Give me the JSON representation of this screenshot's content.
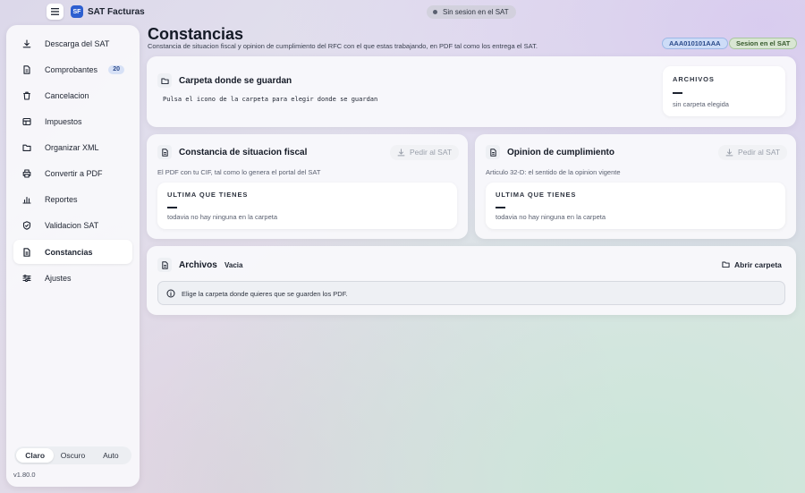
{
  "app": {
    "logo": "SF",
    "title": "SAT Facturas"
  },
  "session_status": "Sin sesion en el SAT",
  "sidebar": {
    "items": [
      {
        "label": "Descarga del SAT",
        "icon": "download-icon"
      },
      {
        "label": "Comprobantes",
        "icon": "document-icon",
        "badge": "20"
      },
      {
        "label": "Cancelacion",
        "icon": "trash-icon"
      },
      {
        "label": "Impuestos",
        "icon": "table-icon"
      },
      {
        "label": "Organizar XML",
        "icon": "folder-icon"
      },
      {
        "label": "Convertir a PDF",
        "icon": "printer-icon"
      },
      {
        "label": "Reportes",
        "icon": "bar-chart-icon"
      },
      {
        "label": "Validacion SAT",
        "icon": "shield-icon"
      },
      {
        "label": "Constancias",
        "icon": "document-icon",
        "active": true
      },
      {
        "label": "Ajustes",
        "icon": "sliders-icon"
      }
    ],
    "theme": {
      "options": [
        "Claro",
        "Oscuro",
        "Auto"
      ],
      "selected": "Claro"
    },
    "version": "v1.80.0"
  },
  "header": {
    "title": "Constancias",
    "subtitle": "Constancia de situacion fiscal y opinion de cumplimiento del RFC con el que estas trabajando, en PDF tal como los entrega el SAT.",
    "rfc": "AAA010101AAA",
    "session_badge": "Sesion en el SAT"
  },
  "folder_card": {
    "title": "Carpeta donde se guardan",
    "hint": "Pulsa el icono de la carpeta para elegir donde se guardan",
    "stat_label": "ARCHIVOS",
    "stat_value": "—",
    "stat_note": "sin carpeta elegida"
  },
  "constancia_card": {
    "title": "Constancia de situacion fiscal",
    "button": "Pedir al SAT",
    "description": "El PDF con tu CIF, tal como lo genera el portal del SAT",
    "stat_label": "ULTIMA QUE TIENES",
    "stat_value": "—",
    "stat_note": "todavia no hay ninguna en la carpeta"
  },
  "opinion_card": {
    "title": "Opinion de cumplimiento",
    "button": "Pedir al SAT",
    "description": "Articulo 32-D: el sentido de la opinion vigente",
    "stat_label": "ULTIMA QUE TIENES",
    "stat_value": "—",
    "stat_note": "todavia no hay ninguna en la carpeta"
  },
  "files_card": {
    "title": "Archivos",
    "chip": "Vacia",
    "open_button": "Abrir carpeta",
    "info": "Elige la carpeta donde quieres que se guarden los PDF."
  },
  "colors": {
    "accent": "#2d5fd0",
    "rfc_badge_bg": "#cddcf7",
    "session_badge_bg": "#d9e6d3",
    "card_bg": "#f8f8fb"
  }
}
